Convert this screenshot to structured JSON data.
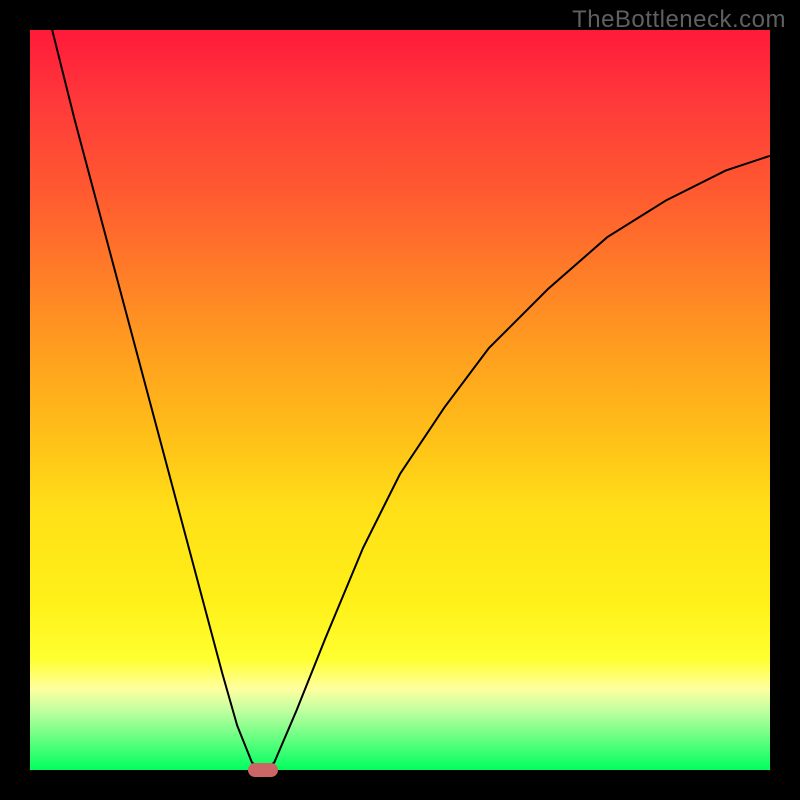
{
  "watermark": "TheBottleneck.com",
  "chart_data": {
    "type": "line",
    "title": "",
    "xlabel": "",
    "ylabel": "",
    "xlim": [
      0,
      100
    ],
    "ylim": [
      0,
      100
    ],
    "gradient_stops": [
      {
        "pos": 0,
        "color": "#ff1a3a"
      },
      {
        "pos": 10,
        "color": "#ff3a3a"
      },
      {
        "pos": 22,
        "color": "#ff5a30"
      },
      {
        "pos": 32,
        "color": "#ff7a28"
      },
      {
        "pos": 42,
        "color": "#ff9a20"
      },
      {
        "pos": 55,
        "color": "#ffc018"
      },
      {
        "pos": 65,
        "color": "#ffe018"
      },
      {
        "pos": 77,
        "color": "#fff018"
      },
      {
        "pos": 85,
        "color": "#ffff30"
      },
      {
        "pos": 89,
        "color": "#ffffa0"
      },
      {
        "pos": 92,
        "color": "#c0ffa0"
      },
      {
        "pos": 96,
        "color": "#60ff80"
      },
      {
        "pos": 100,
        "color": "#00ff60"
      }
    ],
    "series": [
      {
        "name": "bottleneck-curve",
        "x": [
          3,
          6,
          10,
          14,
          18,
          22,
          26,
          28,
          30,
          31.5,
          33,
          36,
          40,
          45,
          50,
          56,
          62,
          70,
          78,
          86,
          94,
          100
        ],
        "y": [
          100,
          88,
          73,
          58,
          43,
          28,
          13,
          6,
          1,
          0,
          1,
          8,
          18,
          30,
          40,
          49,
          57,
          65,
          72,
          77,
          81,
          83
        ]
      }
    ],
    "marker": {
      "x": 31.5,
      "y": 0,
      "color": "#cc6666"
    },
    "curve_color": "#000000",
    "curve_width": 2
  }
}
